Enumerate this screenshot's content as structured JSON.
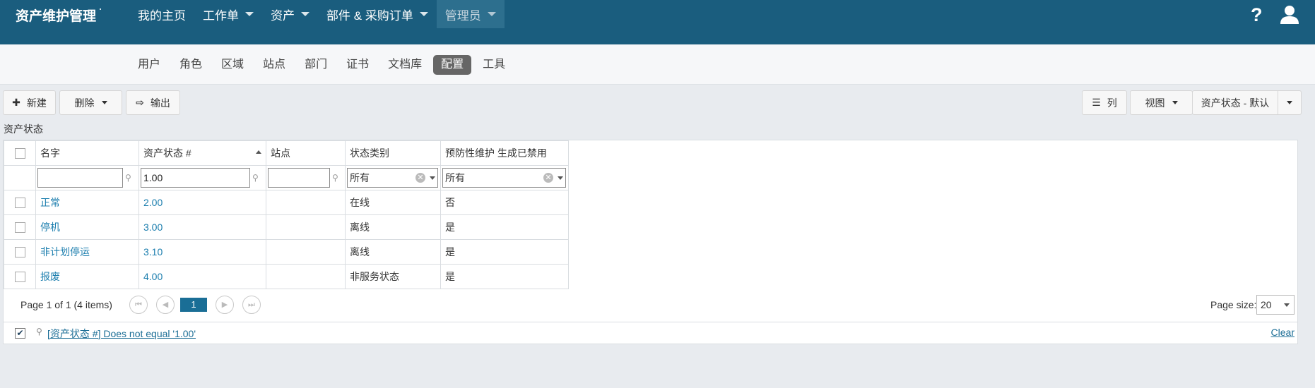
{
  "header": {
    "brand": "资产维护管理",
    "nav": [
      {
        "label": "我的主页",
        "has_caret": false,
        "active": false
      },
      {
        "label": "工作单",
        "has_caret": true,
        "active": false
      },
      {
        "label": "资产",
        "has_caret": true,
        "active": false
      },
      {
        "label": "部件 & 采购订单",
        "has_caret": true,
        "active": false
      },
      {
        "label": "管理员",
        "has_caret": true,
        "active": true
      }
    ],
    "help_symbol": "?"
  },
  "subnav": {
    "items": [
      "用户",
      "角色",
      "区域",
      "站点",
      "部门",
      "证书",
      "文档库",
      "配置",
      "工具"
    ],
    "active": "配置"
  },
  "toolbar": {
    "new_label": "新建",
    "delete_label": "删除",
    "export_label": "输出",
    "columns_label": "列",
    "view_label": "视图",
    "view_selected": "资产状态 - 默认"
  },
  "section_title": "资产状态",
  "grid": {
    "columns": [
      "名字",
      "资产状态 #",
      "站点",
      "状态类别",
      "预防性维护 生成已禁用"
    ],
    "sorted_column": "资产状态 #",
    "filters": {
      "name": "",
      "number": "1.00",
      "site": "",
      "category": "所有",
      "pm_disabled": "所有"
    },
    "rows": [
      {
        "name": "正常",
        "number": "2.00",
        "site": "",
        "category": "在线",
        "pm_disabled": "否"
      },
      {
        "name": "停机",
        "number": "3.00",
        "site": "",
        "category": "离线",
        "pm_disabled": "是"
      },
      {
        "name": "非计划停运",
        "number": "3.10",
        "site": "",
        "category": "离线",
        "pm_disabled": "是"
      },
      {
        "name": "报废",
        "number": "4.00",
        "site": "",
        "category": "非服务状态",
        "pm_disabled": "是"
      }
    ]
  },
  "pager": {
    "summary": "Page 1 of 1 (4 items)",
    "current_page": "1",
    "page_size_label": "Page size:",
    "page_size": "20"
  },
  "filter_expression": {
    "text": "[资产状态 #] Does not equal '1.00'",
    "checked": true,
    "clear_label": "Clear"
  },
  "colors": {
    "topbar": "#1a5d7e",
    "link": "#1c7eae",
    "active_tab": "#666666"
  }
}
